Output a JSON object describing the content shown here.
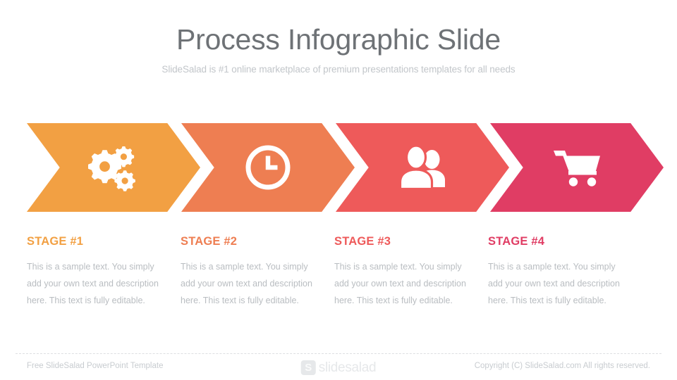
{
  "header": {
    "title": "Process Infographic Slide",
    "subtitle": "SlideSalad is #1 online marketplace of premium presentations templates for all needs"
  },
  "stages": [
    {
      "icon": "gears-icon",
      "color": "#F2A043",
      "heading": "STAGE #1",
      "body": "This is a sample text. You simply add your own text and description here. This text is fully editable."
    },
    {
      "icon": "clock-icon",
      "color": "#EE7E52",
      "heading": "STAGE #2",
      "body": "This is a sample text. You simply add your own text and description here. This text is fully editable."
    },
    {
      "icon": "people-icon",
      "color": "#EE5A5A",
      "heading": "STAGE #3",
      "body": "This is a sample text. You simply add your own text and description here. This text is fully editable."
    },
    {
      "icon": "shopping-cart-icon",
      "color": "#E03D64",
      "heading": "STAGE #4",
      "body": "This is a sample text. You simply add your own text and description here. This text is fully editable."
    }
  ],
  "footer": {
    "left": "Free SlideSalad PowerPoint Template",
    "logo_mark": "S",
    "logo_text": "slidesalad",
    "right": "Copyright (C) SlideSalad.com All rights reserved."
  }
}
